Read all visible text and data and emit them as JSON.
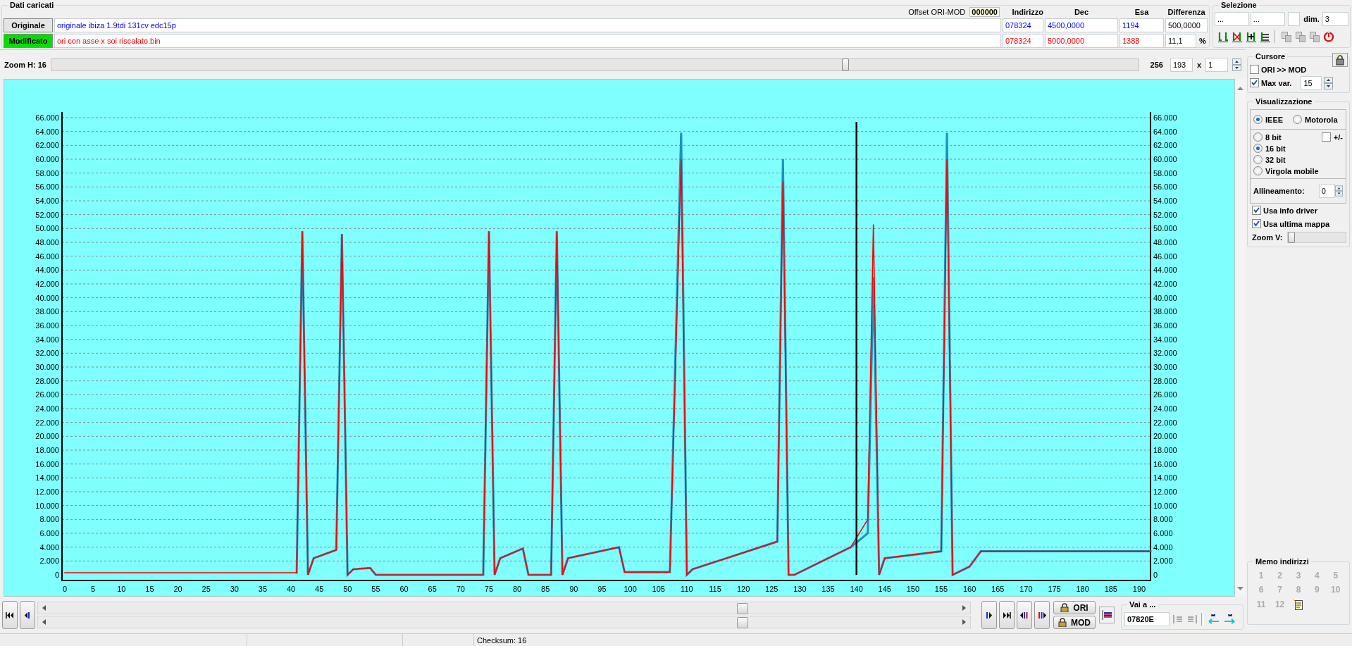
{
  "header": {
    "title": "Dati caricati",
    "offset_label": "Offset ORI-MOD",
    "offset_value": "000000",
    "columns": [
      "Indirizzo",
      "Dec",
      "Esa",
      "Differenza"
    ],
    "files": [
      {
        "button": "Originale",
        "selected": false,
        "name": "originale ibiza 1.9tdi 131cv edc15p",
        "color": "#0000ff",
        "address": "078324",
        "dec": "4500,0000",
        "hex": "1194",
        "diff": "500,0000"
      },
      {
        "button": "Modificato",
        "selected": true,
        "name": "ori con asse x soi riscalato.bin",
        "color": "#ff0000",
        "address": "078324",
        "dec": "5000,0000",
        "hex": "1388",
        "diff": "11,1",
        "unit": "%"
      }
    ]
  },
  "selection": {
    "title": "Selezione",
    "field_1": "...",
    "field_2": "...",
    "dim_label": "dim.",
    "dim_value": "3"
  },
  "zoom_h": {
    "label": "Zoom H: 16",
    "level": 0.73,
    "max": "256",
    "value": "193",
    "times": "x",
    "step": "1"
  },
  "chart": {
    "chart_data": {
      "type": "line",
      "xlim": [
        -0.5,
        192
      ],
      "ylim": [
        0,
        66
      ],
      "xticks": [
        0,
        5,
        10,
        15,
        20,
        25,
        30,
        35,
        40,
        45,
        50,
        55,
        60,
        65,
        70,
        75,
        80,
        85,
        90,
        95,
        100,
        105,
        110,
        115,
        120,
        125,
        130,
        135,
        140,
        145,
        150,
        155,
        160,
        165,
        170,
        175,
        180,
        185,
        190
      ],
      "yticks": [
        {
          "value": 0,
          "label": "0"
        },
        {
          "value": 2,
          "label": "2.000"
        },
        {
          "value": 4,
          "label": "4.000"
        },
        {
          "value": 6,
          "label": "6.000"
        },
        {
          "value": 8,
          "label": "8.000"
        },
        {
          "value": 10,
          "label": "10.000"
        },
        {
          "value": 12,
          "label": "12.000"
        },
        {
          "value": 14,
          "label": "14.000"
        },
        {
          "value": 16,
          "label": "16.000"
        },
        {
          "value": 18,
          "label": "18.000"
        },
        {
          "value": 20,
          "label": "20.000"
        },
        {
          "value": 22,
          "label": "22.000"
        },
        {
          "value": 24,
          "label": "24.000"
        },
        {
          "value": 26,
          "label": "26.000"
        },
        {
          "value": 28,
          "label": "28.000"
        },
        {
          "value": 30,
          "label": "30.000"
        },
        {
          "value": 32,
          "label": "32.000"
        },
        {
          "value": 34,
          "label": "34.000"
        },
        {
          "value": 36,
          "label": "36.000"
        },
        {
          "value": 38,
          "label": "38.000"
        },
        {
          "value": 40,
          "label": "40.000"
        },
        {
          "value": 42,
          "label": "42.000"
        },
        {
          "value": 44,
          "label": "44.000"
        },
        {
          "value": 46,
          "label": "46.000"
        },
        {
          "value": 48,
          "label": "48.000"
        },
        {
          "value": 50,
          "label": "50.000"
        },
        {
          "value": 52,
          "label": "52.000"
        },
        {
          "value": 54,
          "label": "54.000"
        },
        {
          "value": 56,
          "label": "56.000"
        },
        {
          "value": 58,
          "label": "58.000"
        },
        {
          "value": 60,
          "label": "60.000"
        },
        {
          "value": 62,
          "label": "62.000"
        },
        {
          "value": 64,
          "label": "64.000"
        },
        {
          "value": 66,
          "label": "66.000"
        }
      ],
      "x": [
        0,
        41,
        42,
        43,
        44,
        48,
        49,
        50,
        51,
        54,
        55,
        74,
        75,
        76,
        77,
        81,
        82,
        86,
        87,
        88,
        89,
        98,
        99,
        107,
        109,
        110,
        111,
        126,
        127,
        128,
        129,
        139,
        142,
        143,
        144,
        145,
        155,
        156,
        157,
        160,
        162,
        192
      ],
      "series": [
        {
          "color": "#1e90c0",
          "values": [
            null,
            0.3,
            49.6,
            0,
            2.4,
            3.6,
            49.2,
            0,
            0.8,
            1,
            0,
            0,
            49.6,
            0,
            2.4,
            3.8,
            0,
            0,
            49.6,
            0,
            2.4,
            4,
            0.4,
            0.4,
            63.8,
            0,
            0.8,
            4.8,
            60,
            0,
            0,
            4,
            6,
            43,
            0,
            2.4,
            3.4,
            63.8,
            0,
            1.2,
            3.4,
            3.4
          ]
        },
        {
          "color": "#ff0000",
          "values": [
            0.3,
            0.3,
            49.6,
            0,
            2.4,
            3.6,
            49.2,
            0,
            0.8,
            1,
            0,
            0,
            49.6,
            0,
            2.4,
            3.8,
            0,
            0,
            49.6,
            0,
            2.4,
            4,
            0.4,
            0.4,
            60,
            0,
            0.8,
            4.8,
            56.8,
            0,
            0,
            4,
            8,
            50.6,
            0,
            2.4,
            3.4,
            60,
            0,
            1.2,
            3.4,
            3.4
          ]
        }
      ],
      "grid": true,
      "ref_lines": [
        {
          "axis": "x",
          "value": 140,
          "color": "#000000"
        }
      ]
    }
  },
  "cursor_panel": {
    "title": "Cursore",
    "ori_mod": {
      "label": "ORI >> MOD",
      "checked": false
    },
    "max_var": {
      "label": "Max var.",
      "checked": true,
      "value": "15"
    }
  },
  "view": {
    "title": "Visualizzazione",
    "byte_order": [
      {
        "label": "IEEE",
        "selected": true
      },
      {
        "label": "Motorola",
        "selected": false
      }
    ],
    "sizes": [
      {
        "label": "8 bit",
        "selected": false
      },
      {
        "label": "16 bit",
        "selected": true
      },
      {
        "label": "32 bit",
        "selected": false
      },
      {
        "label": "Virgola mobile",
        "selected": false
      }
    ],
    "sign": {
      "label": "+/-",
      "checked": false
    },
    "alignment": {
      "label": "Allineamento:",
      "value": "0"
    },
    "options": [
      {
        "label": "Usa info driver",
        "checked": true
      },
      {
        "label": "Usa ultima mappa",
        "checked": true
      }
    ],
    "zoom_v": {
      "label": "Zoom V:",
      "level": 0
    }
  },
  "navigation": {
    "ori_button": "ORI",
    "mod_button": "MOD",
    "goto_title": "Vai a ...",
    "goto_value": "07820E"
  },
  "memo": {
    "title": "Memo indirizzi",
    "slots": [
      {
        "label": "1",
        "disabled": true
      },
      {
        "label": "2",
        "disabled": true
      },
      {
        "label": "3",
        "disabled": true
      },
      {
        "label": "4",
        "disabled": true
      },
      {
        "label": "5",
        "disabled": true
      },
      {
        "label": "6",
        "disabled": true
      },
      {
        "label": "7",
        "disabled": true
      },
      {
        "label": "8",
        "disabled": true
      },
      {
        "label": "9",
        "disabled": true
      },
      {
        "label": "10",
        "disabled": true
      },
      {
        "label": "11",
        "disabled": true
      },
      {
        "label": "12",
        "disabled": true
      }
    ]
  },
  "status_bar": {
    "checksum": "Checksum: 16"
  }
}
